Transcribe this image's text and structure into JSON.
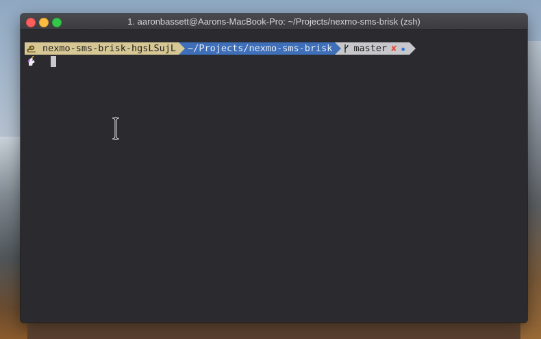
{
  "window": {
    "title": "1. aaronbassett@Aarons-MacBook-Pro: ~/Projects/nexmo-sms-brisk (zsh)"
  },
  "prompt": {
    "virtualenv": "nexmo-sms-brisk-hgsLSujL",
    "path": "~/Projects/nexmo-sms-brisk",
    "git_branch": "master",
    "git_dirty_symbol": "✘",
    "git_staged_symbol": "✹",
    "venv_icon": "python-snake-icon",
    "prompt_icon": "unicorn-icon"
  },
  "colors": {
    "venv_segment": "#d6c794",
    "path_segment": "#3e6fb8",
    "git_segment": "#c8c8cc",
    "dirty": "#e0503a",
    "staged": "#2c6fd6",
    "terminal_bg": "#2b2b2f"
  }
}
